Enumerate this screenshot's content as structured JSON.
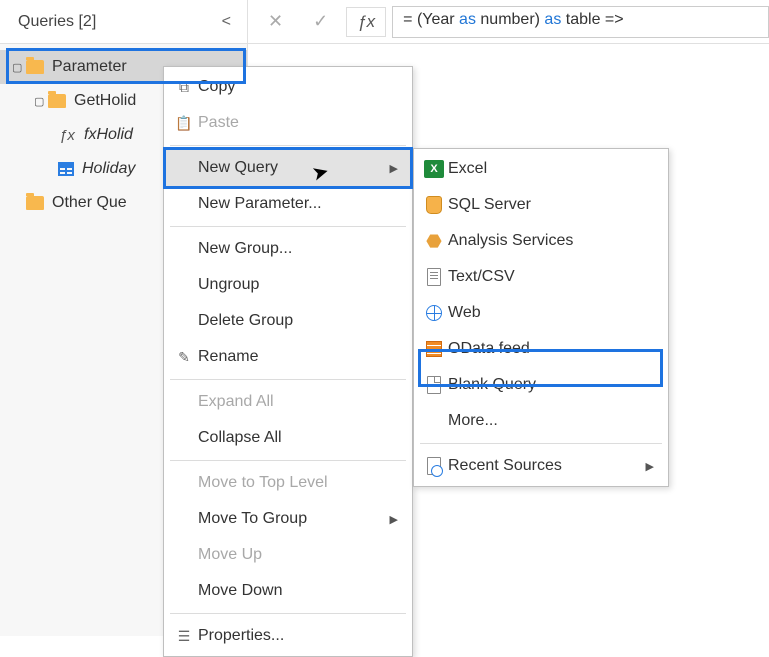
{
  "header": {
    "title": "Queries",
    "count": "[2]"
  },
  "formula_bar": {
    "prefix": "= (Year ",
    "kw1": "as",
    "mid1": " number) ",
    "kw2": "as",
    "mid2": " table =>"
  },
  "tree": {
    "parameter": "Parameter",
    "getholidays": "GetHolid",
    "fxholiday": "fxHolid",
    "holiday": "Holiday",
    "other": "Other Que"
  },
  "content_hint": "ter",
  "menu1": {
    "copy": "Copy",
    "paste": "Paste",
    "new_query": "New Query",
    "new_parameter": "New Parameter...",
    "new_group": "New Group...",
    "ungroup": "Ungroup",
    "delete_group": "Delete Group",
    "rename": "Rename",
    "expand_all": "Expand All",
    "collapse_all": "Collapse All",
    "move_top": "Move to Top Level",
    "move_group": "Move To Group",
    "move_up": "Move Up",
    "move_down": "Move Down",
    "properties": "Properties..."
  },
  "menu2": {
    "excel": "Excel",
    "sql": "SQL Server",
    "analysis": "Analysis Services",
    "textcsv": "Text/CSV",
    "web": "Web",
    "odata": "OData feed",
    "blank": "Blank Query",
    "more": "More...",
    "recent": "Recent Sources"
  }
}
